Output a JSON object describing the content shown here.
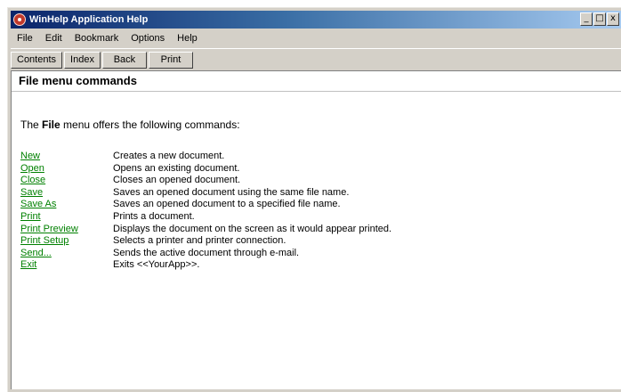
{
  "window": {
    "title": "WinHelp Application Help",
    "controls": {
      "minimize_glyph": "_",
      "maximize_glyph": "□",
      "close_glyph": "x"
    }
  },
  "menubar": {
    "items": [
      {
        "label": "File"
      },
      {
        "label": "Edit"
      },
      {
        "label": "Bookmark"
      },
      {
        "label": "Options"
      },
      {
        "label": "Help"
      }
    ]
  },
  "toolbar": {
    "buttons": [
      {
        "label": "Contents"
      },
      {
        "label": "Index"
      },
      {
        "label": "Back"
      },
      {
        "label": "Print"
      }
    ]
  },
  "content": {
    "title": "File menu commands",
    "intro_prefix": "The ",
    "intro_bold": "File",
    "intro_suffix": " menu offers the following commands:",
    "commands": [
      {
        "name": "New",
        "description": "Creates a new document."
      },
      {
        "name": "Open",
        "description": "Opens an existing document."
      },
      {
        "name": "Close",
        "description": "Closes an opened document."
      },
      {
        "name": "Save",
        "description": "Saves an opened document using the same file name."
      },
      {
        "name": "Save As",
        "description": "Saves an opened document to a specified file name."
      },
      {
        "name": "Print",
        "description": "Prints a document."
      },
      {
        "name": "Print Preview",
        "description": "Displays the document on the screen as it would appear printed."
      },
      {
        "name": "Print Setup",
        "description": "Selects a printer and printer connection."
      },
      {
        "name": "Send...",
        "description": "Sends the active document through e-mail."
      },
      {
        "name": "Exit",
        "description": "Exits <<YourApp>>."
      }
    ]
  },
  "colors": {
    "link": "#008000",
    "titlebar_start": "#0a246a",
    "titlebar_end": "#a6caf0",
    "chrome": "#d4d0c8"
  }
}
